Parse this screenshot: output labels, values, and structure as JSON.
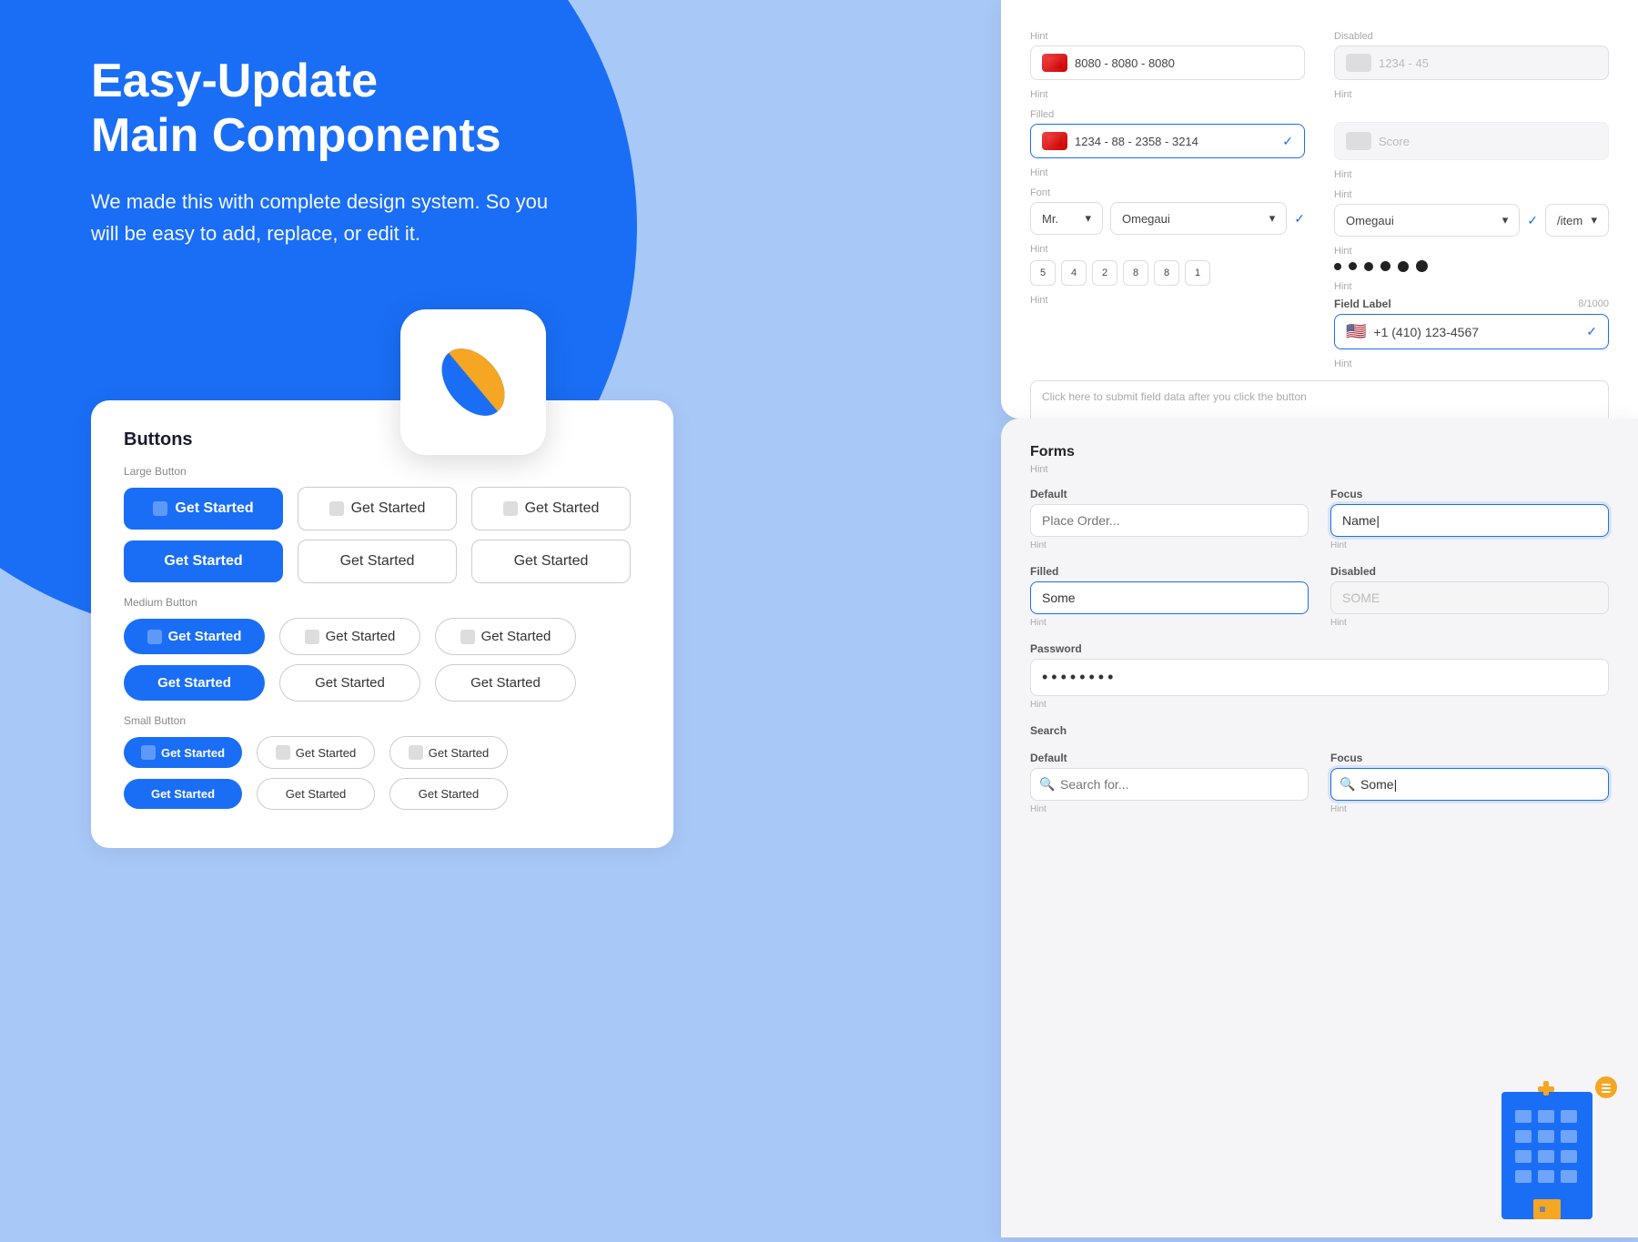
{
  "page": {
    "bg_color": "#a8c8f8"
  },
  "hero": {
    "title": "Easy-Update\nMain Components",
    "description": "We made this with complete design system. So you will be easy to add, replace, or edit it."
  },
  "buttons_panel": {
    "title": "Buttons",
    "large_label": "Large Button",
    "medium_label": "Medium Button",
    "small_label": "Small Button",
    "get_started": "Get Started",
    "rows": [
      {
        "type": "large",
        "variants": [
          "primary-icon",
          "outline-icon",
          "outline-icon"
        ]
      },
      {
        "type": "large",
        "variants": [
          "primary",
          "outline",
          "outline"
        ]
      },
      {
        "type": "medium",
        "variants": [
          "primary-icon",
          "outline-icon",
          "outline-icon"
        ]
      },
      {
        "type": "medium",
        "variants": [
          "primary",
          "outline",
          "outline"
        ]
      },
      {
        "type": "small",
        "variants": [
          "primary-icon",
          "outline-icon",
          "outline-icon"
        ]
      },
      {
        "type": "small",
        "variants": [
          "primary",
          "outline",
          "outline"
        ]
      }
    ]
  },
  "card_form": {
    "label_hint": "Hint",
    "label_filled": "Filled",
    "label_disabled": "Disabled",
    "card_number_placeholder": "8080 - 8080 - 8080",
    "card_number_filled": "1234 - 88 - 2358 - 3214",
    "card_number_disabled": "1234 - 45",
    "font_label": "Font",
    "font_sizes": [
      "5",
      "4",
      "2",
      "8",
      "8",
      "1"
    ],
    "font_dots": [
      8,
      9,
      10,
      11,
      12,
      13
    ],
    "title_label": "Mr.",
    "font_family": "Omegaui",
    "field_label": "Field Label",
    "char_count": "8/1000",
    "phone_country": "+1 (410) 123-4567",
    "textarea_hint": "Click here to submit field data after you click the button"
  },
  "forms_panel": {
    "title": "Forms",
    "hint": "Hint",
    "default_label": "Default",
    "focus_label": "Focus",
    "placeholder_default": "Place Order...",
    "placeholder_focus": "Name|",
    "filled_label": "Filled",
    "disabled_label": "Disabled",
    "filled_value": "Some",
    "disabled_value": "SOME",
    "password_label": "Password",
    "password_dots": "● ● ● ● ● ● ● ●",
    "select_label": "Search",
    "select_default_label": "Default",
    "select_focus_label": "Focus",
    "search_placeholder": "Search for...",
    "search_focus_value": "Some|",
    "hint_text": "Hint"
  },
  "icons": {
    "check": "✓",
    "chevron_down": "▾",
    "search": "🔍",
    "grid_icon": "⊞",
    "box_icon": "☐"
  }
}
